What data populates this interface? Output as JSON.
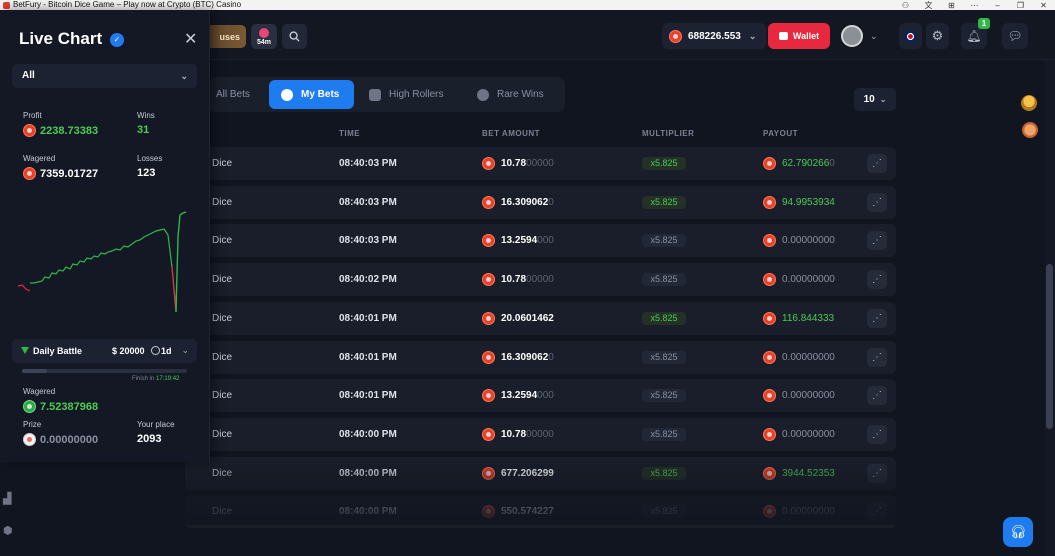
{
  "window": {
    "title": "BetFury - Bitcoin Dice Game – Play now at Crypto (BTC) Casino"
  },
  "topbar": {
    "bonuses_label": "uses",
    "timer_label": "54m",
    "balance": "688226.553",
    "wallet_label": "Wallet",
    "notifications_count": "1"
  },
  "tabs": [
    {
      "label": "All Bets",
      "active": false
    },
    {
      "label": "My Bets",
      "active": true
    },
    {
      "label": "High Rollers",
      "active": false
    },
    {
      "label": "Rare Wins",
      "active": false
    }
  ],
  "page_size": "10",
  "table": {
    "headers": [
      "TIME",
      "BET AMOUNT",
      "MULTIPLIER",
      "PAYOUT"
    ],
    "rows": [
      {
        "game": "Dice",
        "time": "08:40:03 PM",
        "bet": "10.78",
        "bet_trail": "00000",
        "mult": "x5.825",
        "payout": "62.790266",
        "payout_trail": "0",
        "win": true
      },
      {
        "game": "Dice",
        "time": "08:40:03 PM",
        "bet": "16.309062",
        "bet_trail": "0",
        "mult": "x5.825",
        "payout": "94.9953934",
        "payout_trail": "",
        "win": true
      },
      {
        "game": "Dice",
        "time": "08:40:03 PM",
        "bet": "13.2594",
        "bet_trail": "000",
        "mult": "x5.825",
        "payout": "0.00000000",
        "payout_trail": "",
        "win": false
      },
      {
        "game": "Dice",
        "time": "08:40:02 PM",
        "bet": "10.78",
        "bet_trail": "00000",
        "mult": "x5.825",
        "payout": "0.00000000",
        "payout_trail": "",
        "win": false
      },
      {
        "game": "Dice",
        "time": "08:40:01 PM",
        "bet": "20.0601462",
        "bet_trail": "",
        "mult": "x5.825",
        "payout": "116.844333",
        "payout_trail": "",
        "win": true
      },
      {
        "game": "Dice",
        "time": "08:40:01 PM",
        "bet": "16.309062",
        "bet_trail": "0",
        "mult": "x5.825",
        "payout": "0.00000000",
        "payout_trail": "",
        "win": false
      },
      {
        "game": "Dice",
        "time": "08:40:01 PM",
        "bet": "13.2594",
        "bet_trail": "000",
        "mult": "x5.825",
        "payout": "0.00000000",
        "payout_trail": "",
        "win": false
      },
      {
        "game": "Dice",
        "time": "08:40:00 PM",
        "bet": "10.78",
        "bet_trail": "00000",
        "mult": "x5.825",
        "payout": "0.00000000",
        "payout_trail": "",
        "win": false
      },
      {
        "game": "Dice",
        "time": "08:40:00 PM",
        "bet": "677.206299",
        "bet_trail": "",
        "mult": "x5.825",
        "payout": "3944.52353",
        "payout_trail": "",
        "win": true
      },
      {
        "game": "Dice",
        "time": "08:40:00 PM",
        "bet": "550.574227",
        "bet_trail": "",
        "mult": "x5.825",
        "payout": "0.00000000",
        "payout_trail": "",
        "win": false
      }
    ]
  },
  "live_chart": {
    "title": "Live Chart",
    "filter": "All",
    "profit_label": "Profit",
    "profit": "2238.73383",
    "wins_label": "Wins",
    "wins": "31",
    "wagered_label": "Wagered",
    "wagered": "7359.01727",
    "losses_label": "Losses",
    "losses": "123",
    "colors": {
      "up": "#2fb84a",
      "down": "#e8283f"
    }
  },
  "daily_battle": {
    "label": "Daily Battle",
    "prize_pool": "$ 20000",
    "period": "1d",
    "progress_fraction": 0.15,
    "finish_label": "Finish in",
    "finish_time": "17:19:42",
    "wagered_label": "Wagered",
    "wagered": "7.52387968",
    "prize_label": "Prize",
    "prize": "0.00000000",
    "place_label": "Your place",
    "place": "2093"
  },
  "colors": {
    "accent": "#1f7cf0",
    "win": "#4ccc55",
    "wallet": "#e8283f"
  }
}
